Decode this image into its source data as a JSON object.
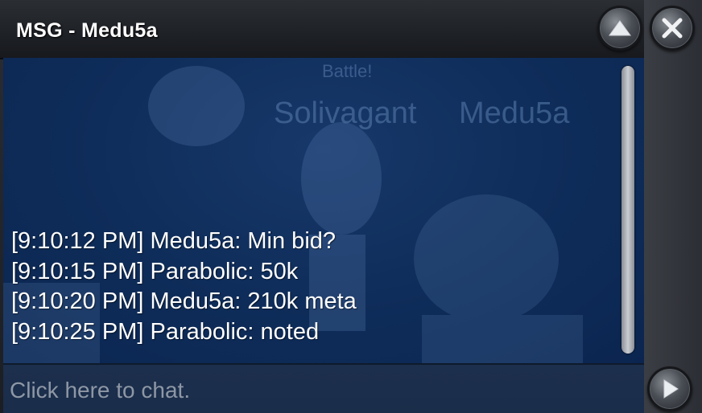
{
  "window": {
    "title": "MSG - Medu5a"
  },
  "buttons": {
    "minimize_icon": "chevron-up-icon",
    "close_icon": "close-icon",
    "send_icon": "play-arrow-icon"
  },
  "background": {
    "battle_label": "Battle!",
    "player1": "Solivagant",
    "player2": "Medu5a"
  },
  "messages": [
    "[9:10:12 PM] Medu5a: Min bid?",
    "[9:10:15 PM] Parabolic: 50k",
    "[9:10:20 PM] Medu5a: 210k meta",
    "[9:10:25 PM] Parabolic: noted"
  ],
  "input": {
    "placeholder": "Click here to chat."
  },
  "colors": {
    "chat_bg": "#0f2d5a",
    "text": "#ffffff",
    "placeholder": "#8e97a5",
    "chrome": "#2b2e33"
  }
}
